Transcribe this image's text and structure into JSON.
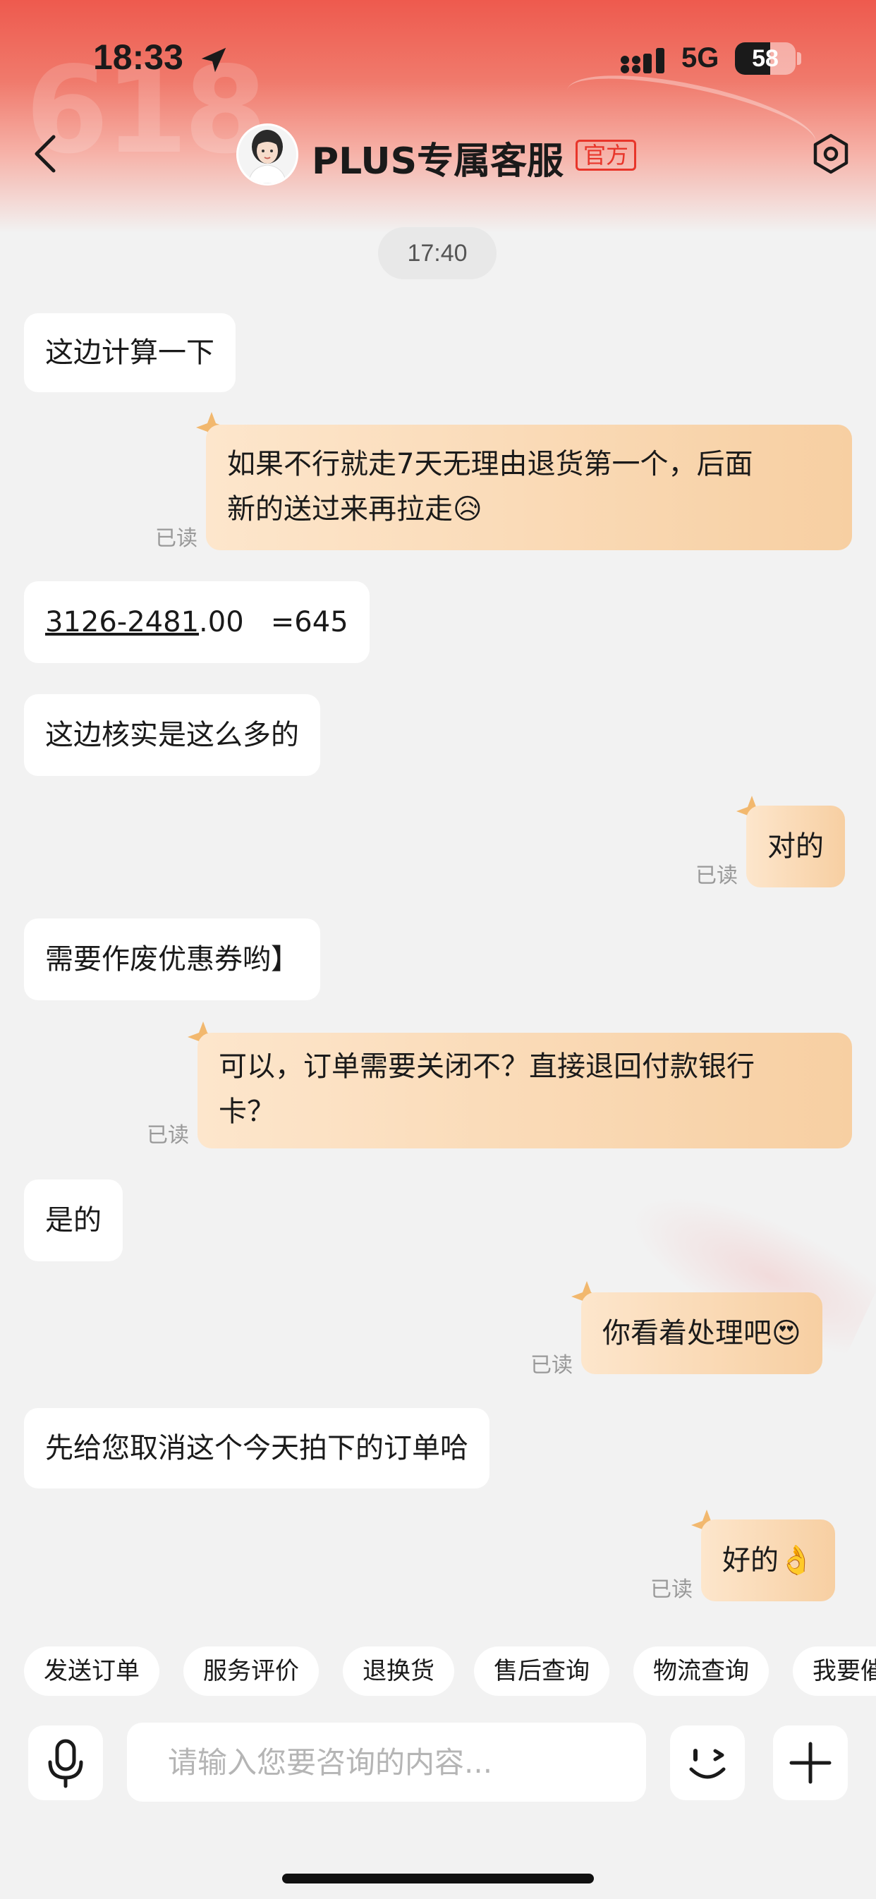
{
  "status_bar": {
    "time": "18:33",
    "network": "5G",
    "battery": "58"
  },
  "header": {
    "title": "PLUS专属客服",
    "badge": "官方"
  },
  "chat": {
    "timestamp": "17:40",
    "messages": [
      {
        "side": "in",
        "text": "这边计算一下"
      },
      {
        "side": "out",
        "text_line1": "如果不行就走7天无理由退货第一个，后面",
        "text_line2": "新的送过来再拉走",
        "emoji": "😥",
        "status": "已读"
      },
      {
        "side": "in",
        "text_underlined": "3126-2481",
        "text_rest": ".00   =645"
      },
      {
        "side": "in",
        "text": "这边核实是这么多的"
      },
      {
        "side": "out",
        "text": "对的",
        "status": "已读"
      },
      {
        "side": "in",
        "text": "需要作废优惠券哟】"
      },
      {
        "side": "out",
        "text_line1": "可以，订单需要关闭不？直接退回付款银行",
        "text_line2": "卡？",
        "status": "已读"
      },
      {
        "side": "in",
        "text": "是的"
      },
      {
        "side": "out",
        "text": "你看着处理吧",
        "emoji": "😍",
        "status": "已读"
      },
      {
        "side": "in",
        "text": "先给您取消这个今天拍下的订单哈"
      },
      {
        "side": "out",
        "text": "好的",
        "emoji": "👌",
        "status": "已读"
      }
    ]
  },
  "quick_replies": [
    "发送订单",
    "服务评价",
    "退换货",
    "售后查询",
    "物流查询",
    "我要催"
  ],
  "input": {
    "placeholder": "请输入您要咨询的内容..."
  },
  "icons": {
    "back": "chevron-left-icon",
    "settings": "settings-hexagon-icon",
    "voice": "microphone-icon",
    "emoji": "wink-face-icon",
    "add": "plus-icon"
  },
  "colors": {
    "header_red": "#ee5a4e",
    "official_badge": "#e8352a",
    "outgoing_bubble": "#f7cfa2",
    "background": "#f2f2f2"
  }
}
